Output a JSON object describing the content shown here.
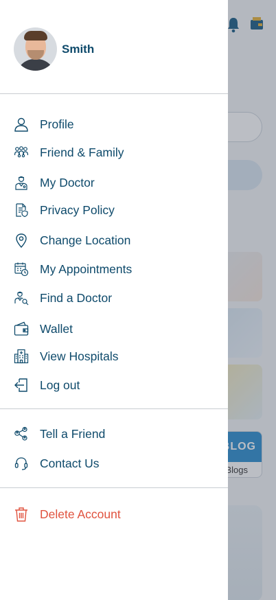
{
  "background": {
    "blog_badge": "BLOG",
    "blog_label": "Blogs"
  },
  "drawer": {
    "user": {
      "name": "Smith"
    },
    "menu_primary": [
      {
        "label": "Profile",
        "icon": "person-icon"
      },
      {
        "label": "Friend & Family",
        "icon": "family-icon"
      },
      {
        "label": "My Doctor",
        "icon": "doctor-icon"
      },
      {
        "label": "Privacy Policy",
        "icon": "policy-icon"
      },
      {
        "label": "Change Location",
        "icon": "location-pin-icon"
      },
      {
        "label": "My Appointments",
        "icon": "calendar-clock-icon"
      },
      {
        "label": "Find a Doctor",
        "icon": "find-doctor-icon"
      },
      {
        "label": "Wallet",
        "icon": "wallet-icon"
      },
      {
        "label": "View Hospitals",
        "icon": "hospital-icon"
      },
      {
        "label": "Log out",
        "icon": "logout-icon"
      }
    ],
    "menu_secondary": [
      {
        "label": "Tell a Friend",
        "icon": "share-icon"
      },
      {
        "label": "Contact Us",
        "icon": "headset-icon"
      }
    ],
    "menu_danger": [
      {
        "label": "Delete Account",
        "icon": "trash-icon"
      }
    ]
  },
  "colors": {
    "primary_text": "#0e4a6b",
    "danger": "#e0523e",
    "divider": "#c8ccd1"
  }
}
